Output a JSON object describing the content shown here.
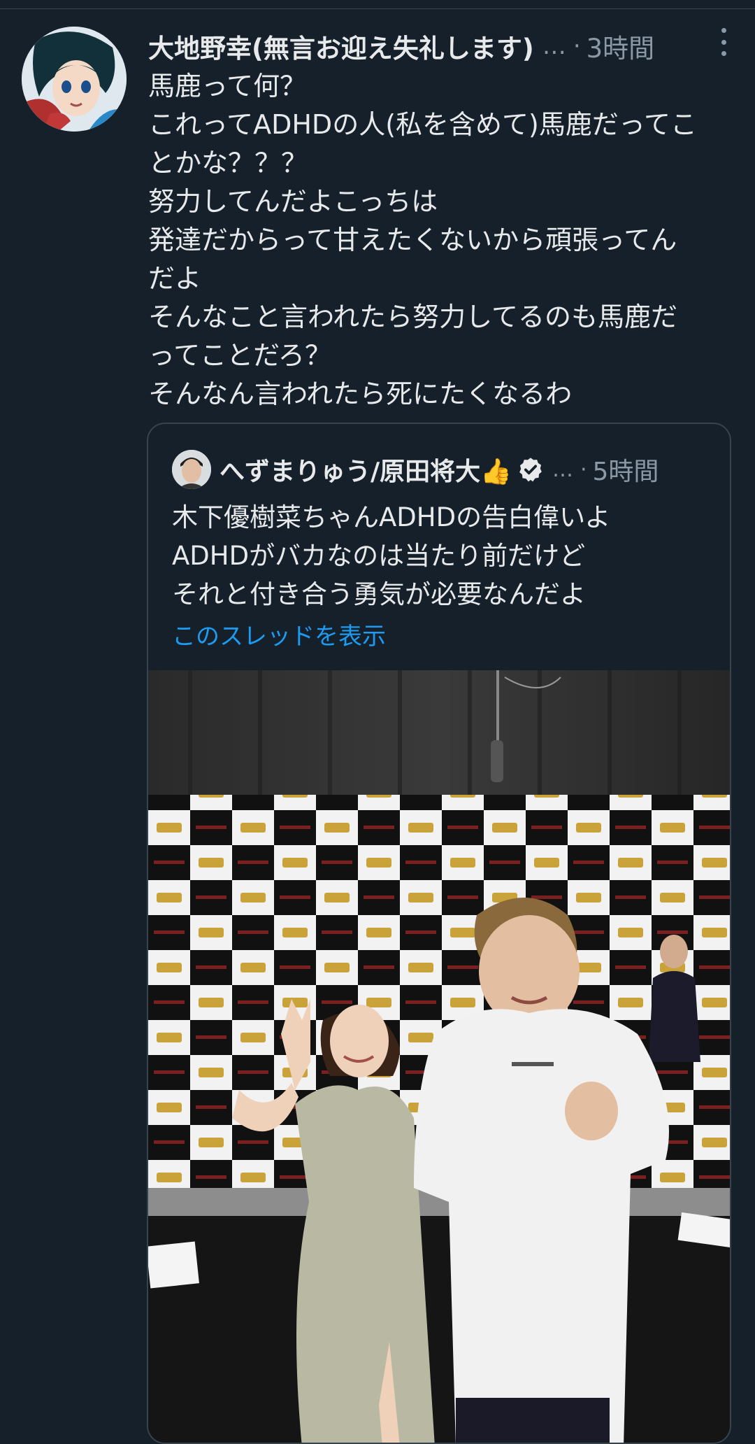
{
  "tweet": {
    "author_name": "大地野幸(無言お迎え失礼します)",
    "name_ellipsis": "…",
    "separator": "·",
    "time": "3時間",
    "avatar_icon": "anime-character-avatar-icon",
    "more_icon": "more-vertical-icon",
    "lines": [
      "馬鹿って何？",
      "これってADHDの人(私を含めて)馬鹿だってこ",
      "とかな？？？",
      "努力してんだよこっちは",
      "発達だからって甘えたくないから頑張ってん",
      "だよ",
      "そんなこと言われたら努力してるのも馬鹿だ",
      "ってことだろ？",
      "そんなん言われたら死にたくなるわ"
    ]
  },
  "quote": {
    "author_name": "へずまりゅう/原田将大👍",
    "verified_icon": "verified-badge-icon",
    "name_ellipsis": "…",
    "separator": "·",
    "time": "5時間",
    "lines": [
      "木下優樹菜ちゃんADHDの告白偉いよ",
      "ADHDがバカなのは当たり前だけど",
      "それと付き合う勇気が必要なんだよ"
    ],
    "thread_link": "このスレッドを表示",
    "photo_icon": "event-photo-image"
  },
  "colors": {
    "background": "#15202b",
    "text": "#e7e9ea",
    "secondary_text": "#8b98a5",
    "link": "#1d9bf0",
    "border": "#38444d"
  }
}
